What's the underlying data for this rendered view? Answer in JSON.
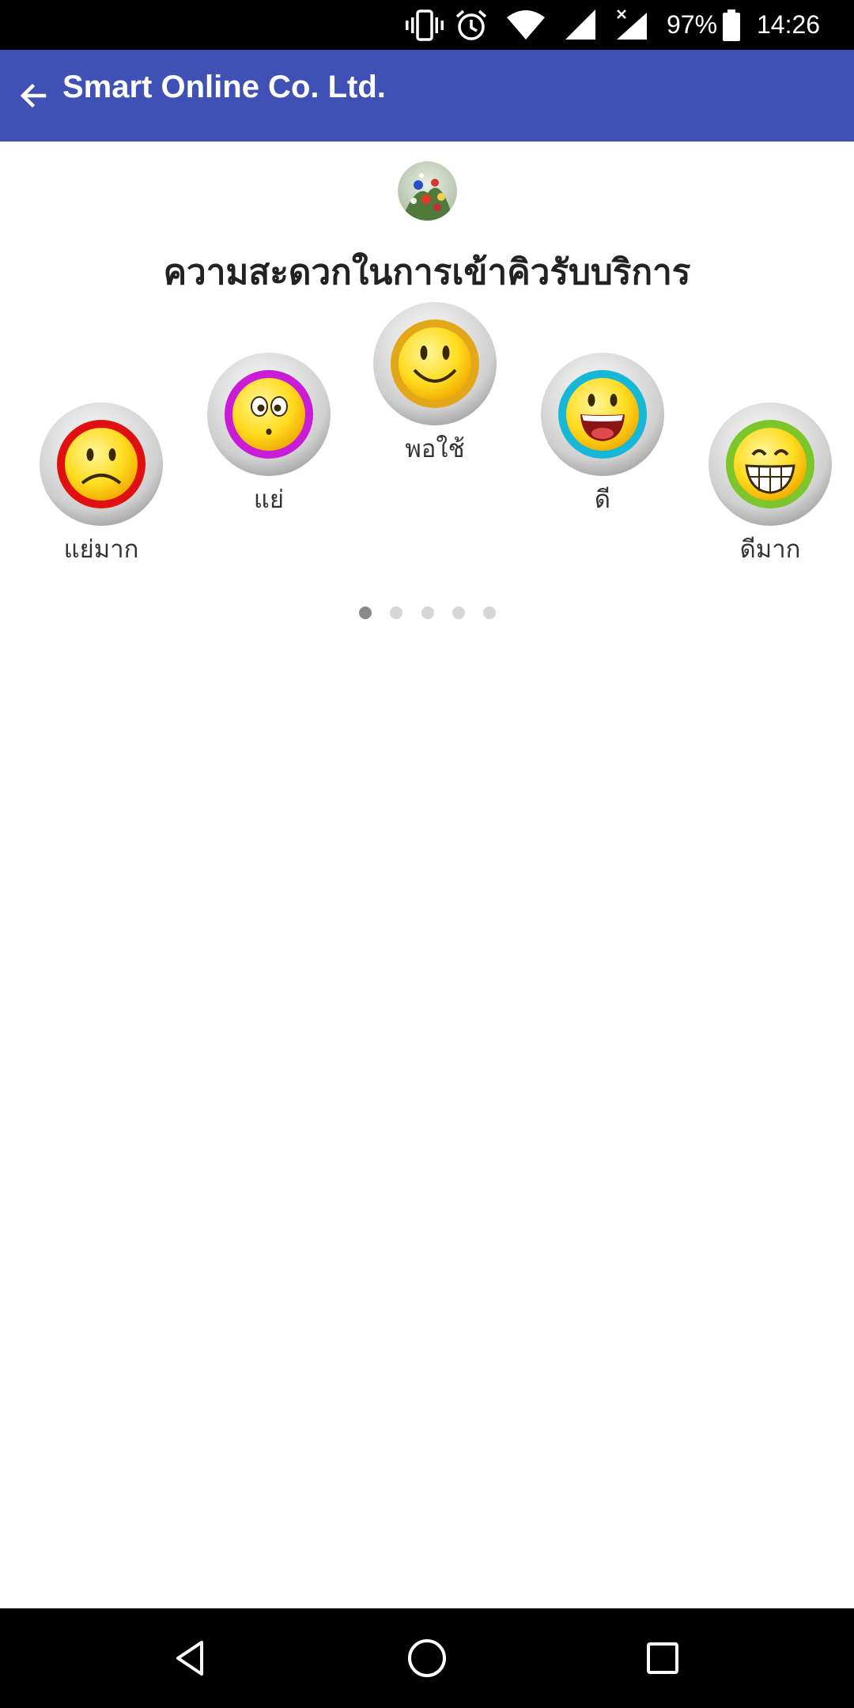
{
  "status_bar": {
    "battery": "97%",
    "time": "14:26",
    "icons": [
      "vibrate-icon",
      "alarm-icon",
      "wifi-icon",
      "signal-icon",
      "signal-no-data-icon",
      "battery-icon"
    ]
  },
  "app_bar": {
    "back_icon": "arrow-back-icon",
    "title": "Smart Online Co. Ltd."
  },
  "survey": {
    "avatar_icon": "flower-avatar",
    "question": "ความสะดวกในการเข้าคิวรับบริการ",
    "options": [
      {
        "label": "แย่มาก",
        "icon": "very-bad-face-icon",
        "color": "#e01010"
      },
      {
        "label": "แย่",
        "icon": "bad-face-icon",
        "color": "#c81cd6"
      },
      {
        "label": "พอใช้",
        "icon": "ok-face-icon",
        "color": "#e3a81a"
      },
      {
        "label": "ดี",
        "icon": "good-face-icon",
        "color": "#17b7d8"
      },
      {
        "label": "ดีมาก",
        "icon": "very-good-face-icon",
        "color": "#7cc52a"
      }
    ],
    "page_indicator": {
      "current": 1,
      "total": 5
    }
  },
  "nav_bar": {
    "icons": [
      "back-nav-icon",
      "home-nav-icon",
      "recents-nav-icon"
    ]
  },
  "colors": {
    "app_bar": "#3f51b5",
    "status_bar": "#000000",
    "background": "#ffffff"
  }
}
